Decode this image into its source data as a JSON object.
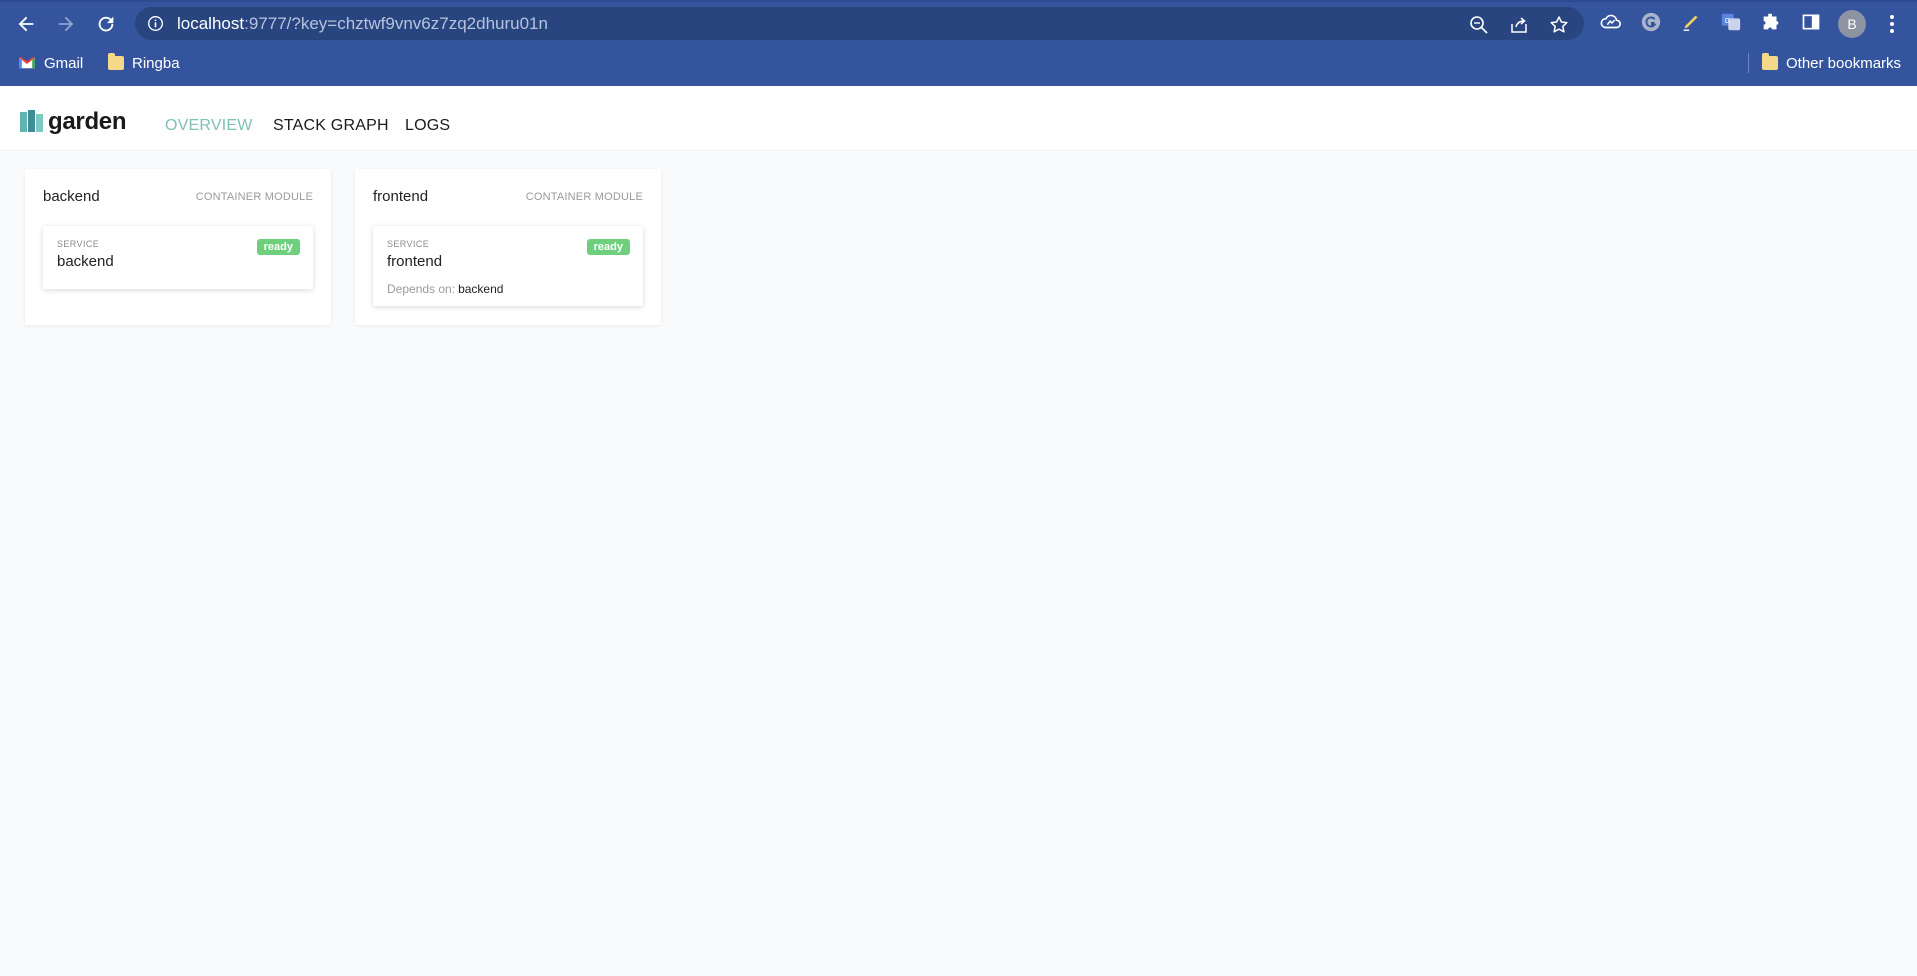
{
  "browser": {
    "url_host": "localhost",
    "url_rest": ":9777/?key=chztwf9vnv6z7zq2dhuru01n",
    "avatar_letter": "B",
    "bookmarks": [
      {
        "label": "Gmail",
        "icon": "gmail-icon"
      },
      {
        "label": "Ringba",
        "icon": "folder-icon"
      }
    ],
    "other_bookmarks": "Other bookmarks"
  },
  "app": {
    "logo_text": "garden",
    "tabs": [
      {
        "label": "OVERVIEW",
        "active": true
      },
      {
        "label": "STACK GRAPH",
        "active": false
      },
      {
        "label": "LOGS",
        "active": false
      }
    ]
  },
  "modules": [
    {
      "name": "backend",
      "type": "CONTAINER MODULE",
      "service": {
        "label": "SERVICE",
        "name": "backend",
        "status": "ready",
        "depends_label": "",
        "depends_on": ""
      }
    },
    {
      "name": "frontend",
      "type": "CONTAINER MODULE",
      "service": {
        "label": "SERVICE",
        "name": "frontend",
        "status": "ready",
        "depends_label": "Depends on:",
        "depends_on": "backend"
      }
    }
  ],
  "colors": {
    "chrome": "#34559d",
    "omnibox": "#284580",
    "active_tab": "#7fbfb6",
    "ready_badge": "#6fcf7c",
    "page_bg": "#f9fafc"
  }
}
